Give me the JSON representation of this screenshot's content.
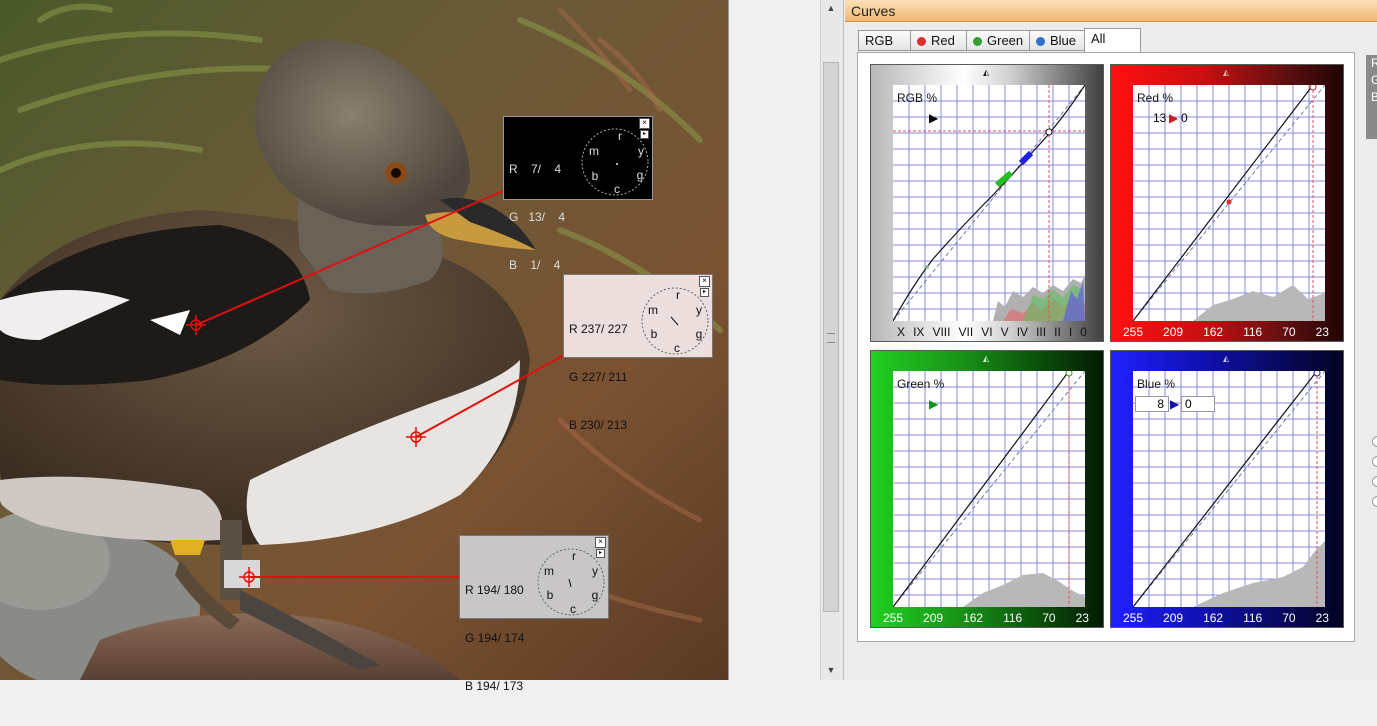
{
  "curves_panel": {
    "title": "Curves",
    "tabs": [
      {
        "label": "RGB",
        "color": ""
      },
      {
        "label": "Red",
        "color": "#d83030"
      },
      {
        "label": "Green",
        "color": "#30a030"
      },
      {
        "label": "Blue",
        "color": "#3070c8"
      },
      {
        "label": "All",
        "color": ""
      }
    ],
    "active_tab": "All",
    "graphs": {
      "rgb": {
        "label": "RGB %",
        "ticks": [
          "X",
          "IX",
          "VIII",
          "VII",
          "VI",
          "V",
          "IV",
          "III",
          "II",
          "I",
          "0"
        ]
      },
      "red": {
        "label": "Red %",
        "value_in": "13",
        "value_out": "0",
        "ticks": [
          "255",
          "209",
          "162",
          "116",
          "70",
          "23"
        ]
      },
      "green": {
        "label": "Green %",
        "ticks": [
          "255",
          "209",
          "162",
          "116",
          "70",
          "23"
        ]
      },
      "blue": {
        "label": "Blue %",
        "value_in": "8",
        "value_out": "0",
        "ticks": [
          "255",
          "209",
          "162",
          "116",
          "70",
          "23"
        ]
      }
    },
    "side_tab_letters": [
      "R",
      "G",
      "B"
    ]
  },
  "probes": [
    {
      "r": "R    7/    4",
      "g": "G   13/    4",
      "b": "B    1/    4",
      "theme": "dark"
    },
    {
      "r": "R 237/ 227",
      "g": "G 227/ 211",
      "b": "B 230/ 213",
      "theme": "light"
    },
    {
      "r": "R 194/ 180",
      "g": "G 194/ 174",
      "b": "B 194/ 173",
      "theme": "gray"
    }
  ],
  "color_wheel_letters": [
    "r",
    "y",
    "g",
    "c",
    "b",
    "m"
  ],
  "colors": {
    "title_bar": "#f5c98a",
    "red_bg": "#c81010",
    "green_bg": "#189018",
    "blue_bg": "#1010b0"
  }
}
